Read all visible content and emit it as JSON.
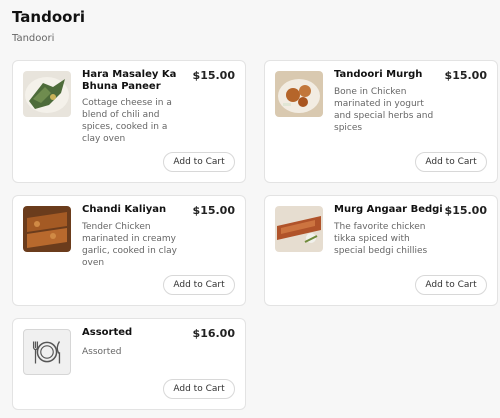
{
  "section": {
    "title": "Tandoori",
    "subtitle": "Tandoori"
  },
  "items": [
    {
      "name": "Hara Masaley Ka Bhuna Paneer",
      "price": "$15.00",
      "description": "Cottage cheese in a blend of chili and spices, cooked in a clay oven",
      "button": "Add to Cart"
    },
    {
      "name": "Tandoori Murgh",
      "price": "$15.00",
      "description": "Bone in Chicken marinated in yogurt and special herbs and spices",
      "button": "Add to Cart"
    },
    {
      "name": "Chandi Kaliyan",
      "price": "$15.00",
      "description": "Tender Chicken marinated in creamy garlic, cooked in clay oven",
      "button": "Add to Cart"
    },
    {
      "name": "Murg Angaar Bedgi",
      "price": "$15.00",
      "description": "The favorite chicken tikka spiced with special bedgi chillies",
      "button": "Add to Cart"
    },
    {
      "name": "Assorted",
      "price": "$16.00",
      "description": "Assorted",
      "button": "Add to Cart"
    }
  ]
}
